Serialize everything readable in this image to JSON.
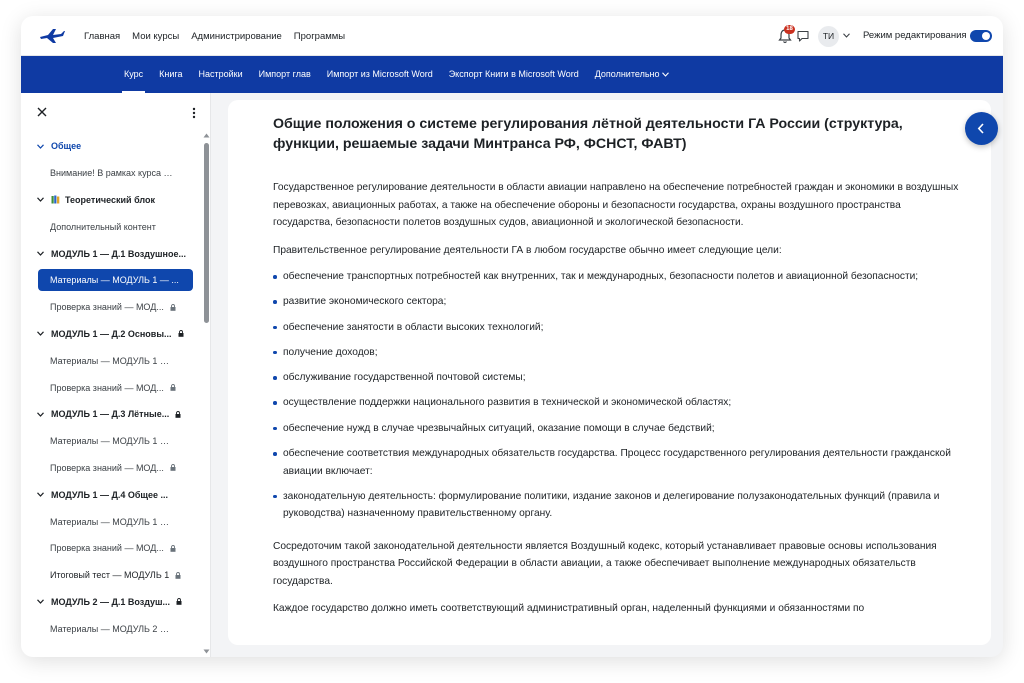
{
  "topbar": {
    "logo_icon": "airplane-logo-icon",
    "nav": [
      "Главная",
      "Мои курсы",
      "Администрирование",
      "Программы"
    ],
    "notifications_count": "18",
    "user_initials": "ТИ",
    "edit_mode_label": "Режим редактирования",
    "edit_mode_on": true
  },
  "secondary_nav": {
    "items": [
      "Курс",
      "Книга",
      "Настройки",
      "Импорт глав",
      "Импорт из Microsoft Word",
      "Экспорт Книги в Microsoft Word"
    ],
    "more_label": "Дополнительно",
    "active": "Курс"
  },
  "sidebar": {
    "items": [
      {
        "label": "Общее"
      },
      {
        "label": "Внимание! В рамках курса р..."
      },
      {
        "label": "Теоретический блок"
      },
      {
        "label": "Дополнительный контент"
      },
      {
        "label": "МОДУЛЬ 1 — Д.1 Воздушное..."
      },
      {
        "label": "Материалы — МОДУЛЬ 1 — ..."
      },
      {
        "label": "Проверка знаний — МОД..."
      },
      {
        "label": "МОДУЛЬ 1 — Д.2 Основы..."
      },
      {
        "label": "Материалы — МОДУЛЬ 1 — ..."
      },
      {
        "label": "Проверка знаний — МОД..."
      },
      {
        "label": "МОДУЛЬ 1 — Д.3 Лётные..."
      },
      {
        "label": "Материалы — МОДУЛЬ 1 — ..."
      },
      {
        "label": "Проверка знаний — МОД..."
      },
      {
        "label": "МОДУЛЬ 1 — Д.4 Общее ..."
      },
      {
        "label": "Материалы — МОДУЛЬ 1 — ..."
      },
      {
        "label": "Проверка знаний — МОД..."
      },
      {
        "label": "Итоговый тест — МОДУЛЬ 1"
      },
      {
        "label": "МОДУЛЬ 2 — Д.1 Воздуш..."
      },
      {
        "label": "Материалы — МОДУЛЬ 2 — ..."
      }
    ]
  },
  "content": {
    "title": "Общие положения о системе регулирования лётной деятельности ГА России (структура, функции, решаемые задачи Минтранса РФ, ФСНСТ, ФАВТ)",
    "p1": "Государственное регулирование деятельности в области авиации направлено на обеспечение потребностей граждан и экономики в воздушных перевозках, авиационных работах, а также на обеспечение обороны и безопасности государства, охраны воздушного пространства государства, безопасности полетов воздушных судов, авиационной и экологической безопасности.",
    "p2": "Правительственное регулирование деятельности ГА в любом государстве обычно имеет следующие цели:",
    "bullets": [
      "обеспечение транспортных потребностей как внутренних, так и международных, безопасности полетов и авиационной безопасности;",
      "развитие экономического сектора;",
      "обеспечение занятости в области высоких технологий;",
      "получение доходов;",
      "обслуживание государственной почтовой системы;",
      "осуществление поддержки национального развития в технической и экономической областях;",
      "обеспечение нужд в случае чрезвычайных ситуаций, оказание помощи в случае бедствий;",
      "обеспечение соответствия международных обязательств государства. Процесс государственного регулирования деятельности гражданской авиации включает:",
      "законодательную деятельность: формулирование политики, издание законов и делегирование полузаконодательных функций (правила и руководства) назначенному правительственному органу."
    ],
    "p3": "Сосредоточим такой законодательной деятельности является Воздушный кодекс, который устанавливает правовые основы использования воздушного пространства Российской Федерации в области авиации, а также обеспечивает выполнение международных обязательств государства.",
    "p4": "Каждое государство должно иметь соответствующий административный орган, наделенный функциями и обязанностями по"
  },
  "colors": {
    "brand": "#0f3aa3",
    "accent": "#0f47ad",
    "badge": "#ca3120"
  }
}
